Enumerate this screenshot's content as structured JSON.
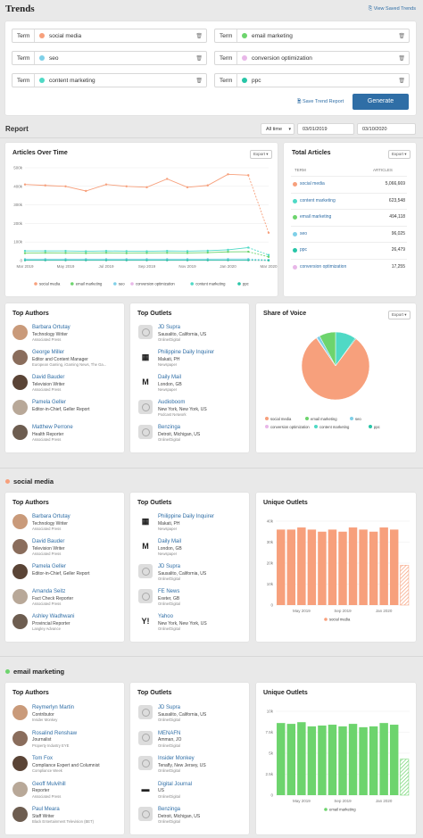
{
  "header": {
    "title": "Trends",
    "view_saved": "View Saved Trends",
    "save_label": "Save Trend Report",
    "generate": "Generate"
  },
  "colors": {
    "social_media": "#f7a07c",
    "email_marketing": "#6dd46d",
    "seo": "#7fd0e8",
    "conversion_optimization": "#e8b7e8",
    "content_marketing": "#4fd9c5",
    "ppc": "#27c5a7",
    "primary": "#2f6ea6"
  },
  "terms": [
    {
      "label": "Term",
      "value": "social media",
      "color": "#f7a07c"
    },
    {
      "label": "Term",
      "value": "email marketing",
      "color": "#6dd46d"
    },
    {
      "label": "Term",
      "value": "seo",
      "color": "#7fd0e8"
    },
    {
      "label": "Term",
      "value": "conversion optimization",
      "color": "#e8b7e8"
    },
    {
      "label": "Term",
      "value": "content marketing",
      "color": "#4fd9c5"
    },
    {
      "label": "Term",
      "value": "ppc",
      "color": "#27c5a7"
    }
  ],
  "report": {
    "title": "Report",
    "range": "All time",
    "start": "03/01/2019",
    "end": "03/10/2020"
  },
  "articles_over_time": {
    "title": "Articles Over Time",
    "export": "Export",
    "y_ticks": [
      "500k",
      "400k",
      "300k",
      "200k",
      "100k",
      "0"
    ],
    "x_ticks": [
      "Mar 2019",
      "May 2019",
      "Jul 2019",
      "Sep 2019",
      "Nov 2019",
      "Jan 2020",
      "Mar 2020"
    ],
    "legend": [
      "social media",
      "email marketing",
      "seo",
      "conversion optimization",
      "content marketing",
      "ppc"
    ]
  },
  "chart_data": [
    {
      "type": "line",
      "title": "Articles Over Time",
      "ylim": [
        0,
        500000
      ],
      "x": [
        "Mar 2019",
        "Apr 2019",
        "May 2019",
        "Jun 2019",
        "Jul 2019",
        "Aug 2019",
        "Sep 2019",
        "Oct 2019",
        "Nov 2019",
        "Dec 2019",
        "Jan 2020",
        "Feb 2020",
        "Mar 2020"
      ],
      "series": [
        {
          "name": "social media",
          "values": [
            410000,
            405000,
            400000,
            375000,
            410000,
            400000,
            395000,
            440000,
            395000,
            405000,
            465000,
            460000,
            150000
          ]
        },
        {
          "name": "email marketing",
          "values": [
            40000,
            42000,
            41000,
            40000,
            42000,
            40000,
            41000,
            42000,
            41000,
            43000,
            47000,
            48000,
            20000
          ]
        },
        {
          "name": "seo",
          "values": [
            8000,
            8000,
            8000,
            8000,
            8000,
            8000,
            8000,
            8000,
            8000,
            8000,
            8500,
            8500,
            4000
          ]
        },
        {
          "name": "conversion optimization",
          "values": [
            1500,
            1500,
            1500,
            1500,
            1500,
            1500,
            1500,
            1500,
            1500,
            1500,
            1500,
            1500,
            800
          ]
        },
        {
          "name": "content marketing",
          "values": [
            52000,
            52000,
            52000,
            50000,
            52000,
            51000,
            50000,
            52000,
            51000,
            53000,
            58000,
            70000,
            30000
          ]
        },
        {
          "name": "ppc",
          "values": [
            2000,
            2000,
            2000,
            2000,
            2000,
            2000,
            2000,
            2000,
            2000,
            2000,
            2200,
            2200,
            1000
          ]
        }
      ]
    },
    {
      "type": "pie",
      "title": "Share of Voice",
      "categories": [
        "social media",
        "email marketing",
        "seo",
        "conversion optimization",
        "content marketing",
        "ppc"
      ],
      "values": [
        5066669,
        494118,
        96025,
        17255,
        623548,
        26479
      ]
    },
    {
      "type": "bar",
      "title": "Unique Outlets",
      "legend": "social media",
      "ylim": [
        0,
        40000
      ],
      "y_ticks": [
        "40k",
        "30k",
        "20k",
        "10k",
        "0"
      ],
      "x_ticks": [
        "May 2019",
        "Sep 2019",
        "Jan 2020"
      ],
      "values": [
        36000,
        36000,
        37000,
        36000,
        35000,
        36000,
        35000,
        37000,
        36000,
        35000,
        37000,
        36000,
        19000
      ]
    },
    {
      "type": "bar",
      "title": "Unique Outlets",
      "legend": "email marketing",
      "ylim": [
        0,
        10000
      ],
      "y_ticks": [
        "10k",
        "7.5k",
        "5k",
        "2.5k",
        "0"
      ],
      "x_ticks": [
        "May 2019",
        "Sep 2019",
        "Jan 2020"
      ],
      "values": [
        8600,
        8500,
        8700,
        8200,
        8300,
        8400,
        8200,
        8500,
        8100,
        8200,
        8600,
        8400,
        4300
      ]
    }
  ],
  "total_articles": {
    "title": "Total Articles",
    "export": "Export",
    "col_term": "TERM",
    "col_articles": "ARTICLES",
    "rows": [
      {
        "term": "social media",
        "count": "5,066,669",
        "color": "#f7a07c"
      },
      {
        "term": "content marketing",
        "count": "623,548",
        "color": "#4fd9c5"
      },
      {
        "term": "email marketing",
        "count": "494,118",
        "color": "#6dd46d"
      },
      {
        "term": "seo",
        "count": "96,025",
        "color": "#7fd0e8"
      },
      {
        "term": "ppc",
        "count": "26,479",
        "color": "#27c5a7"
      },
      {
        "term": "conversion optimization",
        "count": "17,255",
        "color": "#e8b7e8"
      }
    ]
  },
  "share_of_voice": {
    "title": "Share of Voice",
    "export": "Export"
  },
  "sections": {
    "social": "social media",
    "email": "email marketing"
  },
  "labels": {
    "top_authors": "Top Authors",
    "top_outlets": "Top Outlets",
    "unique_outlets": "Unique Outlets"
  },
  "authors_all": [
    {
      "name": "Barbara Ortutay",
      "role": "Technology Writer",
      "org": "Associated Press"
    },
    {
      "name": "George Miller",
      "role": "Editor and Content Manager",
      "org": "European Gaming, iGaming News, The Ga..."
    },
    {
      "name": "David Bauder",
      "role": "Television Writer",
      "org": "Associated Press"
    },
    {
      "name": "Pamela Geller",
      "role": "Editor-in-Chief, Geller Report",
      "org": ""
    },
    {
      "name": "Matthew Perrone",
      "role": "Health Reporter",
      "org": "Associated Press"
    }
  ],
  "outlets_all": [
    {
      "name": "JD Supra",
      "loc": "Sausalito, California, US",
      "type": "Online/Digital",
      "logo": ""
    },
    {
      "name": "Philippine Daily Inquirer",
      "loc": "Makati, PH",
      "type": "Newspaper",
      "logo": "▦"
    },
    {
      "name": "Daily Mail",
      "loc": "London, GB",
      "type": "Newspaper",
      "logo": "M"
    },
    {
      "name": "Audioboom",
      "loc": "New York, New York, US",
      "type": "Podcast Network",
      "logo": ""
    },
    {
      "name": "Benzinga",
      "loc": "Detroit, Michigan, US",
      "type": "Online/Digital",
      "logo": ""
    }
  ],
  "authors_social": [
    {
      "name": "Barbara Ortutay",
      "role": "Technology Writer",
      "org": "Associated Press"
    },
    {
      "name": "David Bauder",
      "role": "Television Writer",
      "org": "Associated Press"
    },
    {
      "name": "Pamela Geller",
      "role": "Editor-in-Chief, Geller Report",
      "org": ""
    },
    {
      "name": "Amanda Seitz",
      "role": "Fact Check Reporter",
      "org": "Associated Press"
    },
    {
      "name": "Ashley Wadhwani",
      "role": "Provincial Reporter",
      "org": "Langley Advance"
    }
  ],
  "outlets_social": [
    {
      "name": "Philippine Daily Inquirer",
      "loc": "Makati, PH",
      "type": "Newspaper",
      "logo": "▦"
    },
    {
      "name": "Daily Mail",
      "loc": "London, GB",
      "type": "Newspaper",
      "logo": "M"
    },
    {
      "name": "JD Supra",
      "loc": "Sausalito, California, US",
      "type": "Online/Digital",
      "logo": ""
    },
    {
      "name": "FE News",
      "loc": "Exeter, GB",
      "type": "Online/Digital",
      "logo": ""
    },
    {
      "name": "Yahoo",
      "loc": "New York, New York, US",
      "type": "Online/Digital",
      "logo": "Y!"
    }
  ],
  "authors_email": [
    {
      "name": "Reymerlyn Martin",
      "role": "Contributor",
      "org": "Insider Monkey"
    },
    {
      "name": "Rosalind Renshaw",
      "role": "Journalist",
      "org": "Property Industry EYE"
    },
    {
      "name": "Tom Fox",
      "role": "Compliance Expert and Columnist",
      "org": "Compliance Week"
    },
    {
      "name": "Geoff Mulvihill",
      "role": "Reporter",
      "org": "Associated Press"
    },
    {
      "name": "Paul Meara",
      "role": "Staff Writer",
      "org": "Black Entertainment Television (BET)"
    }
  ],
  "outlets_email": [
    {
      "name": "JD Supra",
      "loc": "Sausalito, California, US",
      "type": "Online/Digital",
      "logo": ""
    },
    {
      "name": "MENAFN",
      "loc": "Amman, JO",
      "type": "Online/Digital",
      "logo": ""
    },
    {
      "name": "Insider Monkey",
      "loc": "Tenafly, New Jersey, US",
      "type": "Online/Digital",
      "logo": ""
    },
    {
      "name": "Digital Journal",
      "loc": "US",
      "type": "Online/Digital",
      "logo": "▬"
    },
    {
      "name": "Benzinga",
      "loc": "Detroit, Michigan, US",
      "type": "Online/Digital",
      "logo": ""
    }
  ]
}
